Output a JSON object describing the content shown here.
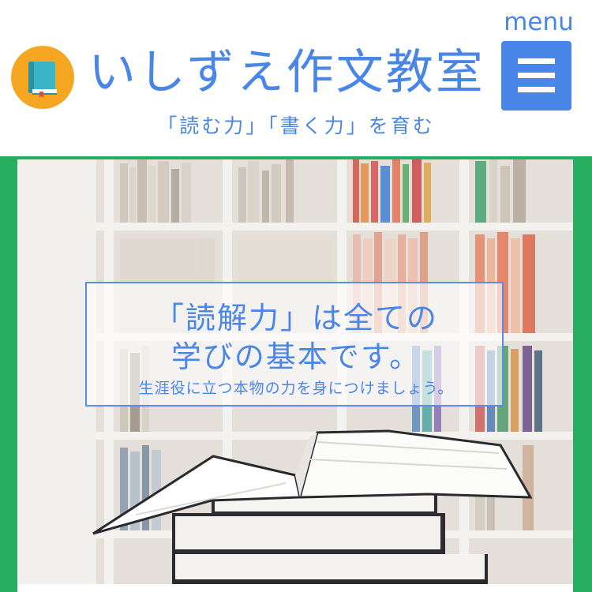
{
  "header": {
    "site_title": "いしずえ作文教室",
    "tagline": "「読む力」「書く力」を育む",
    "menu_label": "menu",
    "logo_icon": "book-icon",
    "menu_icon": "hamburger-icon"
  },
  "hero": {
    "headline_line1": "「読解力」は全ての",
    "headline_line2": "学びの基本です。",
    "subline": "生涯役に立つ本物の力を身につけましょう。",
    "image": "books-on-shelf-photo"
  },
  "colors": {
    "accent_blue": "#4a86e8",
    "frame_green": "#27ad5f",
    "logo_orange": "#f5a623",
    "book_teal": "#3ab5c6"
  }
}
